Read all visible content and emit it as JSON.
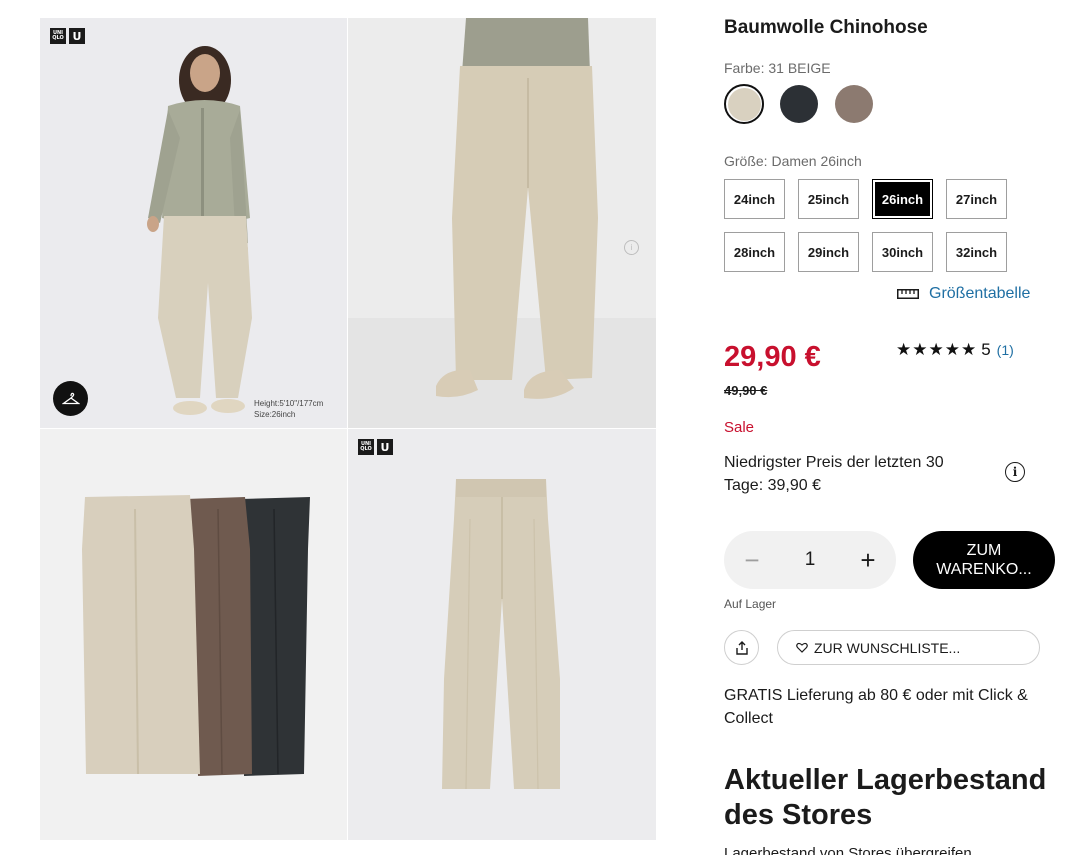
{
  "product": {
    "title": "Baumwolle Chinohose",
    "color_label": "Farbe: 31 BEIGE",
    "colors": [
      {
        "name": "beige",
        "hex": "#d9d1c0",
        "selected": true
      },
      {
        "name": "navy",
        "hex": "#2c3035",
        "selected": false
      },
      {
        "name": "brown",
        "hex": "#8c7a70",
        "selected": false
      }
    ],
    "size_label": "Größe: Damen 26inch",
    "sizes": [
      "24inch",
      "25inch",
      "26inch",
      "27inch",
      "28inch",
      "29inch",
      "30inch",
      "32inch"
    ],
    "selected_size": "26inch",
    "size_chart_label": "Größentabelle",
    "price": "29,90 €",
    "old_price": "49,90 €",
    "rating_stars": "★★★★★",
    "rating_value": "5",
    "rating_count": "(1)",
    "rating": 5,
    "sale_label": "Sale",
    "lowest_price_text": "Niedrigster Preis der letzten 30 Tage: 39,90 €",
    "quantity": "1",
    "cart_button": "ZUM WARENKO...",
    "stock_status": "Auf Lager",
    "wishlist_label": "ZUR WUNSCHLISTE...",
    "delivery_text": "GRATIS Lieferung ab 80 € oder mit Click & Collect",
    "stores_heading": "Aktueller Lagerbestand des Stores",
    "stores_note": "Lagerbestand von Stores übergreifen"
  },
  "gallery": {
    "logo_top": "UNI",
    "logo_bottom": "QLO",
    "logo_u": "U",
    "model_height": "Height:5'10\"/177cm",
    "model_size": "Size:26inch"
  },
  "colors": {
    "sale_red": "#c8102e",
    "link_blue": "#1f6fa3"
  }
}
